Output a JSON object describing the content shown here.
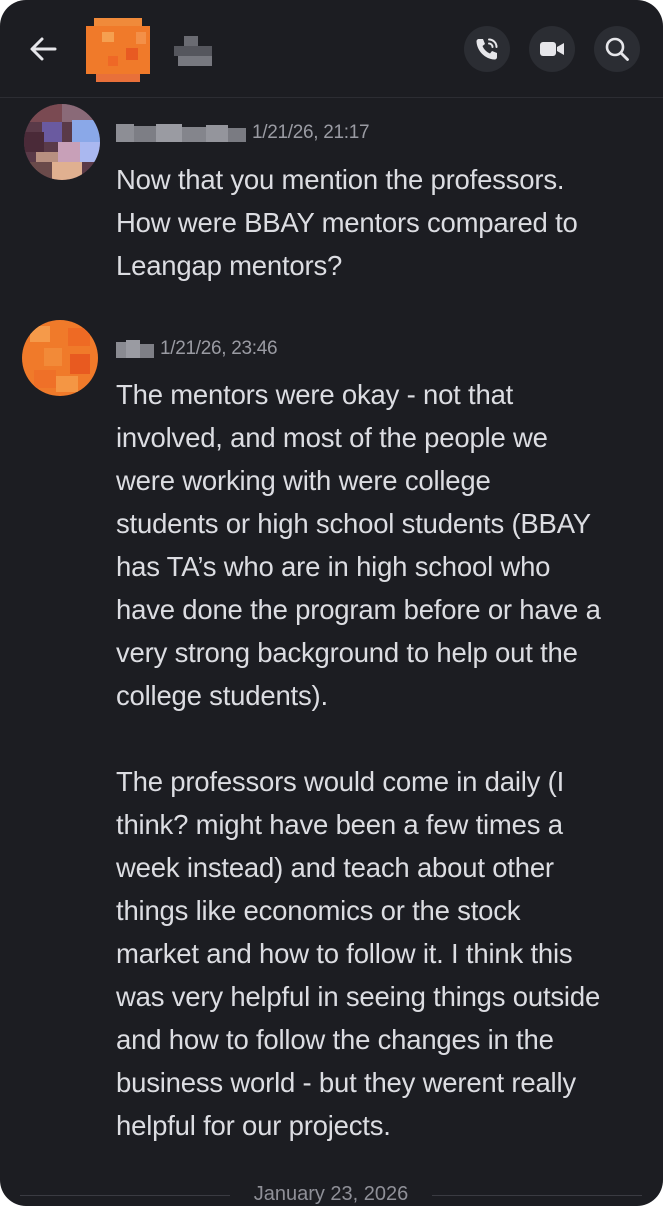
{
  "header": {
    "icons": {
      "back": "arrow-left-icon",
      "call": "phone-call-icon",
      "video": "video-camera-icon",
      "search": "search-icon"
    },
    "colors": {
      "background": "#1c1d22",
      "button_bg": "#2b2d33",
      "avatar_orange": "#f07a2a"
    }
  },
  "messages": [
    {
      "timestamp": "1/21/26, 21:17",
      "text": "Now that you mention the professors.\nHow were BBAY mentors compared to\nLeangap mentors?"
    },
    {
      "timestamp": "1/21/26, 23:46",
      "text": "The mentors were okay - not that\ninvolved, and most of the people we\nwere working with were college\nstudents or high school students (BBAY\nhas TA’s who are in high school who\nhave done the program before or have a\nvery strong background to help out the\ncollege students).\n\nThe professors would come in daily (I\nthink? might have been a few times a\nweek instead) and teach about other\nthings like economics or the stock\nmarket and how to follow it. I think this\nwas very helpful in seeing things outside\nand how to follow the changes in the\nbusiness world - but they werent really\nhelpful for our projects."
    }
  ],
  "date_divider": "January 23, 2026"
}
